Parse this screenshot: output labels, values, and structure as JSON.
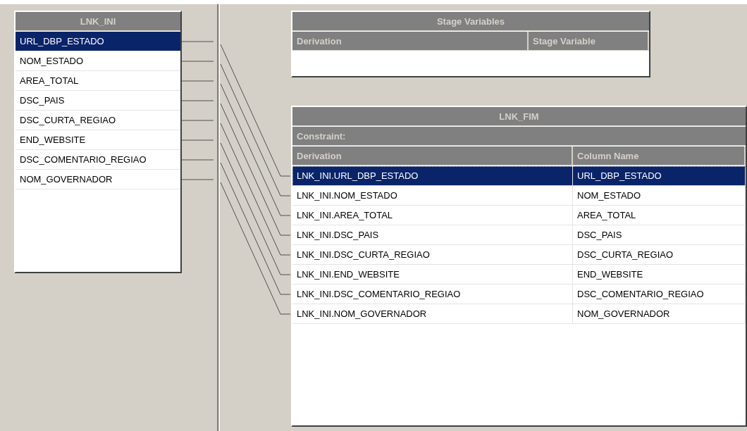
{
  "input_link": {
    "title": "LNK_INI",
    "rows": [
      {
        "name": "URL_DBP_ESTADO",
        "selected": true
      },
      {
        "name": "NOM_ESTADO",
        "selected": false
      },
      {
        "name": "AREA_TOTAL",
        "selected": false
      },
      {
        "name": "DSC_PAIS",
        "selected": false
      },
      {
        "name": "DSC_CURTA_REGIAO",
        "selected": false
      },
      {
        "name": "END_WEBSITE",
        "selected": false
      },
      {
        "name": "DSC_COMENTARIO_REGIAO",
        "selected": false
      },
      {
        "name": "NOM_GOVERNADOR",
        "selected": false
      }
    ]
  },
  "stage_variables": {
    "title": "Stage Variables",
    "columns": [
      "Derivation",
      "Stage Variable"
    ]
  },
  "output_link": {
    "title": "LNK_FIM",
    "constraint_label": "Constraint:",
    "columns": [
      "Derivation",
      "Column Name"
    ],
    "rows": [
      {
        "derivation": "LNK_INI.URL_DBP_ESTADO",
        "column_name": "URL_DBP_ESTADO",
        "selected": true
      },
      {
        "derivation": "LNK_INI.NOM_ESTADO",
        "column_name": "NOM_ESTADO",
        "selected": false
      },
      {
        "derivation": "LNK_INI.AREA_TOTAL",
        "column_name": "AREA_TOTAL",
        "selected": false
      },
      {
        "derivation": "LNK_INI.DSC_PAIS",
        "column_name": "DSC_PAIS",
        "selected": false
      },
      {
        "derivation": "LNK_INI.DSC_CURTA_REGIAO",
        "column_name": "DSC_CURTA_REGIAO",
        "selected": false
      },
      {
        "derivation": "LNK_INI.END_WEBSITE",
        "column_name": "END_WEBSITE",
        "selected": false
      },
      {
        "derivation": "LNK_INI.DSC_COMENTARIO_REGIAO",
        "column_name": "DSC_COMENTARIO_REGIAO",
        "selected": false
      },
      {
        "derivation": "LNK_INI.NOM_GOVERNADOR",
        "column_name": "NOM_GOVERNADOR",
        "selected": false
      }
    ]
  }
}
